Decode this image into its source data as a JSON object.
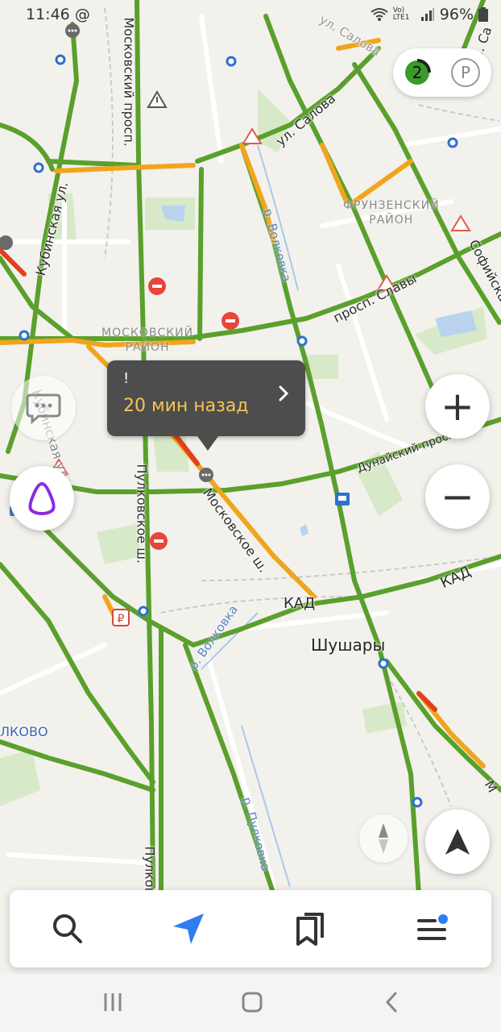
{
  "status_bar": {
    "time": "11:46",
    "at_icon": "@",
    "network": "Vo) LTE1",
    "battery": "96%"
  },
  "map": {
    "streets": {
      "moskovsky_prosp": "Московский просп.",
      "salova_top": "ул. Салова",
      "salova": "ул. Салова",
      "kubinskaya": "Кубинская ул.",
      "kubinskaya_2": "Кубинская ул.",
      "slavy": "просп. Славы",
      "sofiyskaya": "Софийская",
      "dunaysky": "Дунайский просп.",
      "moskovskoe": "Московское ш.",
      "pulkovskoe": "Пулковское ш.",
      "pulkovskoe_2": "Пулково",
      "kad": "КАД",
      "kad_2": "КАД",
      "ul_sa": "ул. Са",
      "m_right": "М"
    },
    "districts": {
      "frunzensky": "ФРУНЗЕНСКИЙ\nРАЙОН",
      "moskovsky": "МОСКОВСКИЙ\nРАЙОН"
    },
    "places": {
      "shushary": "Шушары",
      "pulkovo": "ЛКОВО"
    },
    "rivers": {
      "volkovka": "р. Волковка",
      "volkovka_2": "р. Волковка",
      "pulkovka": "р. Пулковка"
    },
    "traffic_colors": {
      "free": "#5aa02c",
      "slow": "#f0a51d",
      "jam": "#e23f1d"
    }
  },
  "popup": {
    "title": "!",
    "time_ago": "20 мин назад"
  },
  "traffic_badge": {
    "level": "2",
    "color": "#3a9a2a"
  },
  "parking_label": "P",
  "zoom": {
    "in": "+",
    "out": "−"
  },
  "bottom_bar": {
    "search": "search-icon",
    "route": "navigation-arrow-icon",
    "bookmarks": "bookmarks-icon",
    "menu": "menu-icon",
    "menu_badge_color": "#2f7ef0"
  }
}
